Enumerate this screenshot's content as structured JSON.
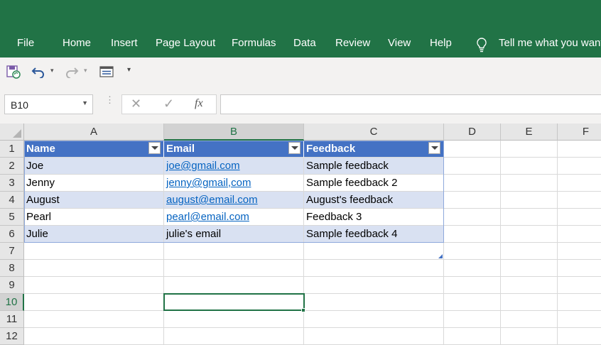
{
  "ribbon": {
    "tabs": [
      "File",
      "Home",
      "Insert",
      "Page Layout",
      "Formulas",
      "Data",
      "Review",
      "View",
      "Help"
    ],
    "tell_me": "Tell me what you want to do",
    "color": "#217346"
  },
  "quick_access": {
    "icons": [
      "autosave-icon",
      "undo-icon",
      "undo-dropdown-icon",
      "redo-icon",
      "redo-dropdown-icon",
      "form-icon",
      "customize-toolbar-icon"
    ]
  },
  "formula_bar": {
    "name_box": "B10",
    "cancel_symbol": "✕",
    "enter_symbol": "✓",
    "fx_label": "fx",
    "value": ""
  },
  "sheet": {
    "columns": [
      "A",
      "B",
      "C",
      "D",
      "E",
      "F"
    ],
    "selected_column": "B",
    "rows": [
      "1",
      "2",
      "3",
      "4",
      "5",
      "6",
      "7",
      "8",
      "9",
      "10",
      "11",
      "12"
    ],
    "selected_row": "10",
    "selected_cell": "B10",
    "table": {
      "headers": [
        "Name",
        "Email",
        "Feedback"
      ],
      "header_color": "#4472c4",
      "band_color": "#d9e1f2",
      "rows": [
        {
          "name": "Joe",
          "email": "joe@gmail.com",
          "email_is_link": true,
          "feedback": "Sample feedback"
        },
        {
          "name": "Jenny",
          "email": "jenny@gmail,com",
          "email_is_link": true,
          "feedback": "Sample feedback 2"
        },
        {
          "name": "August",
          "email": "august@email.com",
          "email_is_link": true,
          "feedback": "August's feedback"
        },
        {
          "name": "Pearl",
          "email": "pearl@email.com",
          "email_is_link": true,
          "feedback": "Feedback 3"
        },
        {
          "name": "Julie",
          "email": "julie's email",
          "email_is_link": false,
          "feedback": "Sample feedback 4"
        }
      ]
    }
  }
}
